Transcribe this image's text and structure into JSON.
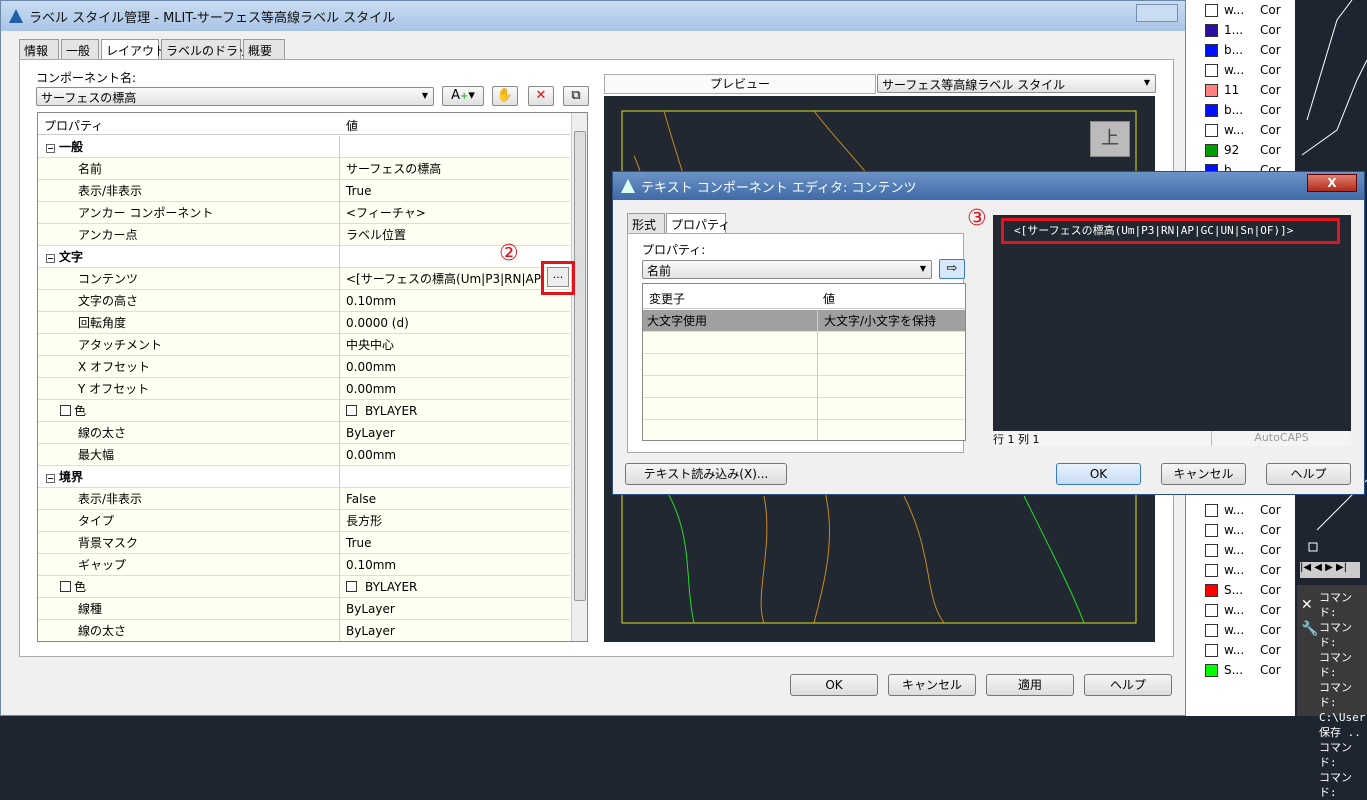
{
  "main": {
    "title": "ラベル スタイル管理 - MLIT-サーフェス等高線ラベル スタイル",
    "tabs": [
      "情報",
      "一般",
      "レイアウト",
      "ラベルのドラッグ",
      "概要"
    ],
    "component_label": "コンポーネント名:",
    "component_value": "サーフェスの標高",
    "grid_headers": [
      "プロパティ",
      "値"
    ],
    "rows": [
      {
        "type": "cat",
        "name": "一般",
        "value": ""
      },
      {
        "name": "名前",
        "value": "サーフェスの標高"
      },
      {
        "name": "表示/非表示",
        "value": "True"
      },
      {
        "name": "アンカー コンポーネント",
        "value": "<フィーチャ>"
      },
      {
        "name": "アンカー点",
        "value": "ラベル位置"
      },
      {
        "type": "cat",
        "name": "文字",
        "value": ""
      },
      {
        "name": "コンテンツ",
        "value": "<[サーフェスの標高(Um|P3|RN|AP"
      },
      {
        "name": "文字の高さ",
        "value": "0.10mm"
      },
      {
        "name": "回転角度",
        "value": "0.0000 (d)"
      },
      {
        "name": "アタッチメント",
        "value": "中央中心"
      },
      {
        "name": "X オフセット",
        "value": "0.00mm"
      },
      {
        "name": "Y オフセット",
        "value": "0.00mm"
      },
      {
        "type": "chk",
        "name": "色",
        "value": "BYLAYER"
      },
      {
        "name": "線の太さ",
        "value": "ByLayer"
      },
      {
        "name": "最大幅",
        "value": "0.00mm"
      },
      {
        "type": "cat",
        "name": "境界",
        "value": ""
      },
      {
        "name": "表示/非表示",
        "value": "False"
      },
      {
        "name": "タイプ",
        "value": "長方形"
      },
      {
        "name": "背景マスク",
        "value": "True"
      },
      {
        "name": "ギャップ",
        "value": "0.10mm"
      },
      {
        "type": "chk",
        "name": "色",
        "value": "BYLAYER"
      },
      {
        "name": "線種",
        "value": "ByLayer"
      },
      {
        "name": "線の太さ",
        "value": "ByLayer"
      }
    ],
    "ellipsis": "...",
    "annotation2": "②",
    "annotation3": "③",
    "preview_label": "プレビュー",
    "preview_style": "サーフェス等高線ラベル スタイル",
    "viewcube": "上",
    "buttons": {
      "ok": "OK",
      "cancel": "キャンセル",
      "apply": "適用",
      "help": "ヘルプ"
    }
  },
  "editor": {
    "title": "テキスト コンポーネント エディタ: コンテンツ",
    "tabs": [
      "形式",
      "プロパティ"
    ],
    "property_label": "プロパティ:",
    "property_value": "名前",
    "headers": [
      "変更子",
      "値"
    ],
    "rows": [
      {
        "mod": "大文字使用",
        "value": "大文字/小文字を保持"
      }
    ],
    "content": "<[サーフェスの標高(Um|P3|RN|AP|GC|UN|Sn|OF)]>",
    "status_pos": "行 1 列 1",
    "status_caps": "AutoCAPS",
    "import_button": "テキスト読み込み(X)...",
    "ok": "OK",
    "cancel": "キャンセル",
    "help": "ヘルプ",
    "close": "X"
  },
  "layers": {
    "top": [
      {
        "n": "w...",
        "c": "#ffffff"
      },
      {
        "n": "1...",
        "c": "#2a0fa0"
      },
      {
        "n": "b...",
        "c": "#0010ff"
      },
      {
        "n": "w...",
        "c": "#ffffff"
      },
      {
        "n": "11",
        "c": "#ff8080"
      },
      {
        "n": "b...",
        "c": "#0010ff"
      },
      {
        "n": "w...",
        "c": "#ffffff"
      },
      {
        "n": "92",
        "c": "#00a000"
      },
      {
        "n": "b...",
        "c": "#0010ff"
      }
    ],
    "bottom": [
      {
        "n": "w...",
        "c": "#ffffff"
      },
      {
        "n": "w...",
        "c": "#ffffff"
      },
      {
        "n": "w...",
        "c": "#ffffff"
      },
      {
        "n": "w...",
        "c": "#ffffff"
      },
      {
        "n": "S...",
        "c": "#ff0000"
      },
      {
        "n": "w...",
        "c": "#ffffff"
      },
      {
        "n": "w...",
        "c": "#ffffff"
      },
      {
        "n": "w...",
        "c": "#ffffff"
      },
      {
        "n": "S...",
        "c": "#00ff00"
      }
    ],
    "col": "Cor"
  },
  "command": {
    "lines": [
      "コマンド:",
      "コマンド:",
      "コマンド:",
      "コマンド:",
      "C:\\User",
      "保存 ..",
      "コマンド:",
      "コマンド:"
    ]
  },
  "colors": {
    "highlight": "#e0141e",
    "canvas": "#212832"
  }
}
